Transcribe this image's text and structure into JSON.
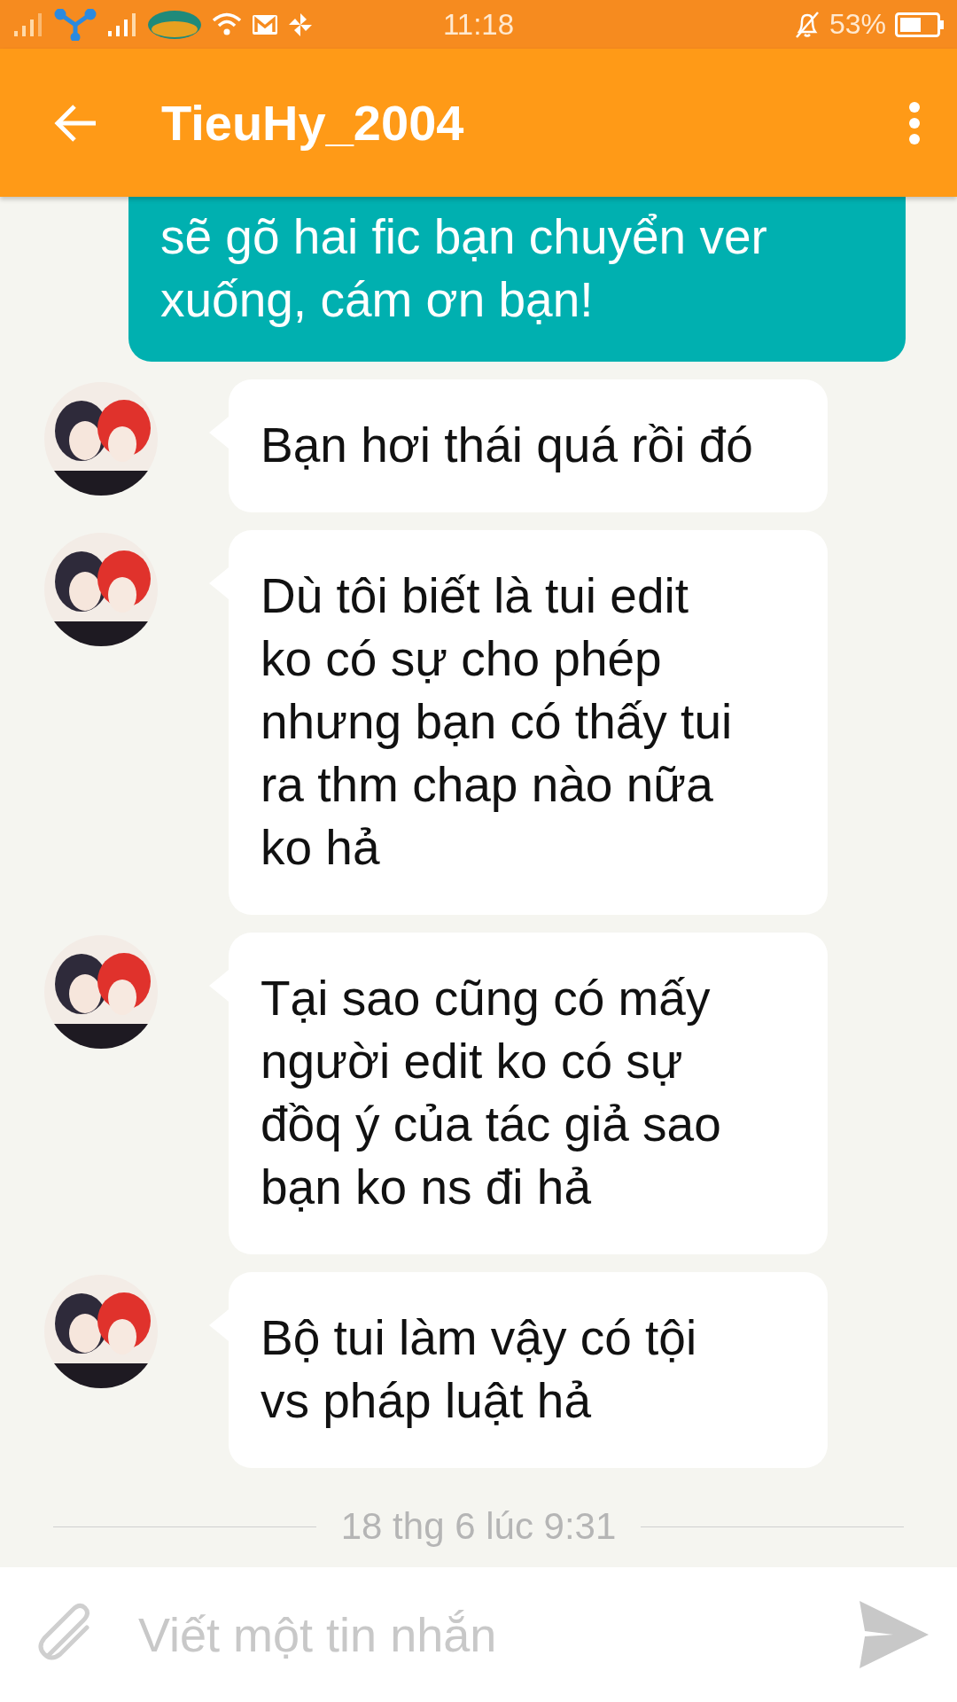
{
  "status_bar": {
    "time": "11:18",
    "battery": "53%"
  },
  "header": {
    "title": "TieuHy_2004"
  },
  "messages": [
    {
      "kind": "outgoing",
      "text": "sẽ gõ hai fic bạn chuyển ver\nxuống, cám ơn bạn!"
    },
    {
      "kind": "incoming",
      "text": "Bạn hơi thái quá rồi đó"
    },
    {
      "kind": "incoming",
      "text": "Dù tôi biết là tui edit\nko có sự cho phép\nnhưng bạn có thấy tui\nra thm chap nào nữa\nko hả"
    },
    {
      "kind": "incoming",
      "text": "Tại sao cũng có mấy\nngười edit ko có sự\nđồq ý của tác giả sao\nbạn ko ns đi hả"
    },
    {
      "kind": "incoming",
      "text": "Bộ tui làm vậy có tội\nvs pháp luật hả"
    }
  ],
  "date_separator": "18 thg 6 lúc 9:31",
  "composer": {
    "placeholder": "Viết một tin nhắn"
  }
}
